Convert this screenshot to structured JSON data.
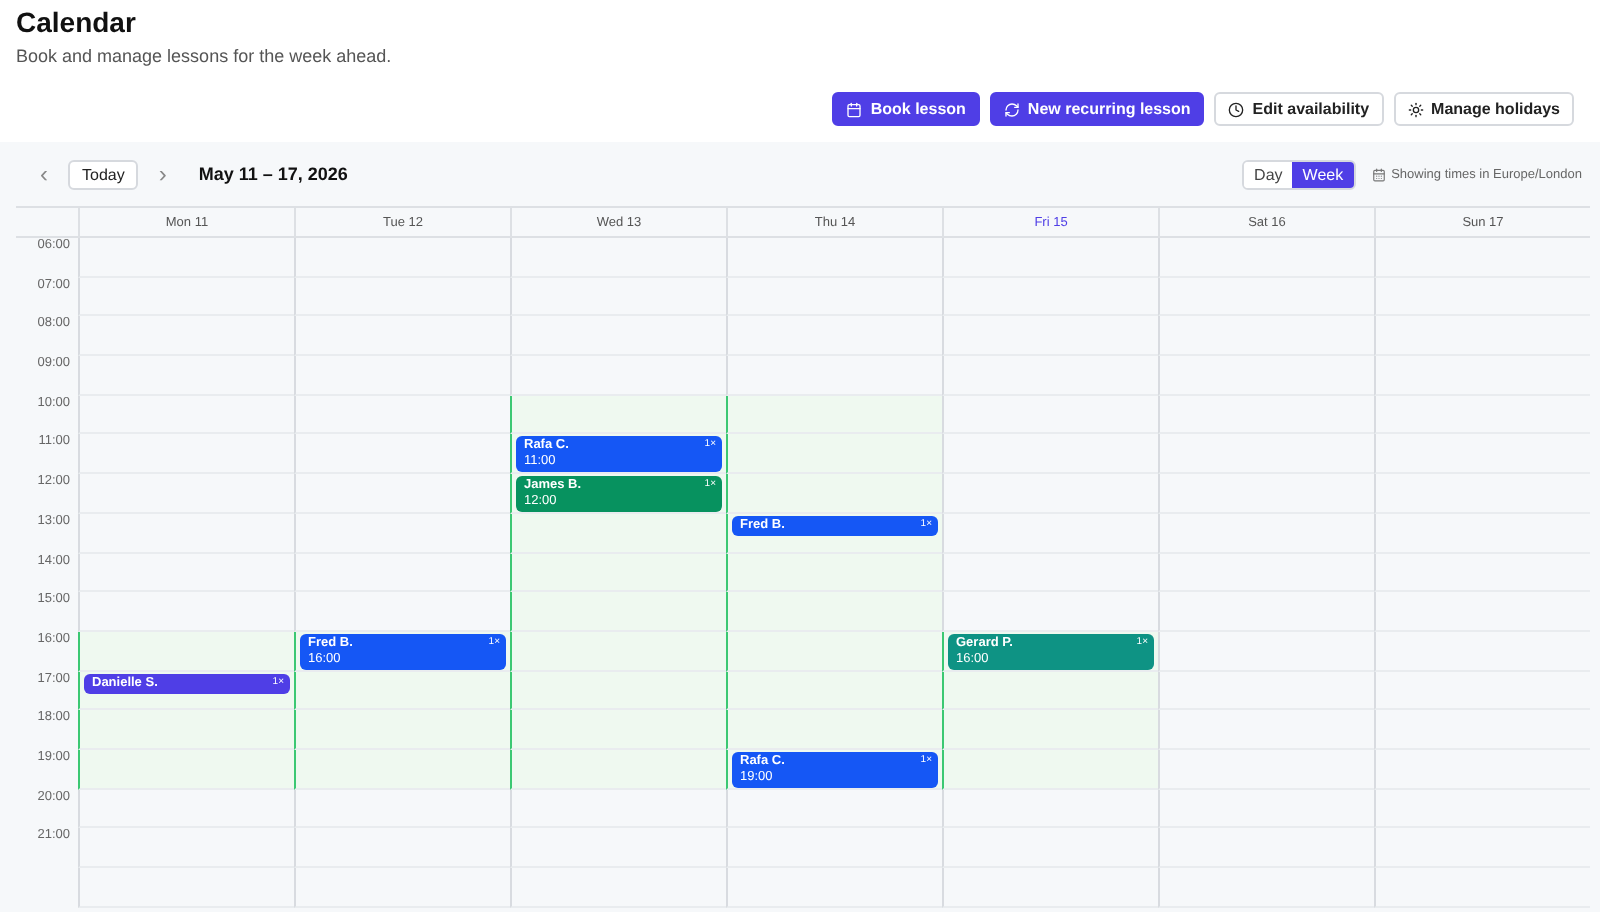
{
  "header": {
    "title": "Calendar",
    "subtitle": "Book and manage lessons for the week ahead."
  },
  "actions": [
    {
      "label": "Book lesson",
      "kind": "primary"
    },
    {
      "label": "New recurring lesson",
      "kind": "primary"
    },
    {
      "label": "Edit availability",
      "kind": "secondary"
    },
    {
      "label": "Manage holidays",
      "kind": "secondary"
    }
  ],
  "toolbar": {
    "prev": "‹",
    "today": "Today",
    "next": "›",
    "range": "May 11 – 17, 2026",
    "views": [
      {
        "label": "Day",
        "selected": false
      },
      {
        "label": "Week",
        "selected": true
      }
    ],
    "timezone": "Showing times in Europe/London"
  },
  "days": [
    {
      "label": "Mon 11",
      "selected": false
    },
    {
      "label": "Tue 12",
      "selected": false
    },
    {
      "label": "Wed 13",
      "selected": false
    },
    {
      "label": "Thu 14",
      "selected": false
    },
    {
      "label": "Fri 15",
      "selected": true
    },
    {
      "label": "Sat 16",
      "selected": false
    },
    {
      "label": "Sun 17",
      "selected": false
    }
  ],
  "rows": [
    {
      "label": "06:00",
      "cells": [
        {
          "kind": "closed"
        },
        {
          "kind": "closed"
        },
        {
          "kind": "closed"
        },
        {
          "kind": "closed"
        },
        {
          "kind": "closed"
        },
        {
          "kind": "closed"
        },
        {
          "kind": "closed"
        }
      ]
    },
    {
      "label": "07:00",
      "cells": [
        {
          "kind": "closed"
        },
        {
          "kind": "closed"
        },
        {
          "kind": "closed"
        },
        {
          "kind": "closed"
        },
        {
          "kind": "closed"
        },
        {
          "kind": "closed"
        },
        {
          "kind": "closed"
        }
      ]
    },
    {
      "label": "08:00",
      "cells": [
        {
          "kind": "closed"
        },
        {
          "kind": "closed"
        },
        {
          "kind": "closed"
        },
        {
          "kind": "closed"
        },
        {
          "kind": "closed"
        },
        {
          "kind": "closed"
        },
        {
          "kind": "closed"
        }
      ]
    },
    {
      "label": "09:00",
      "cells": [
        {
          "kind": "closed"
        },
        {
          "kind": "closed"
        },
        {
          "kind": "closed"
        },
        {
          "kind": "closed"
        },
        {
          "kind": "closed"
        },
        {
          "kind": "closed"
        },
        {
          "kind": "closed"
        }
      ]
    },
    {
      "label": "10:00",
      "cells": [
        {
          "kind": "closed"
        },
        {
          "kind": "closed"
        },
        {
          "kind": "open"
        },
        {
          "kind": "open"
        },
        {
          "kind": "closed"
        },
        {
          "kind": "closed"
        },
        {
          "kind": "closed"
        }
      ]
    },
    {
      "label": "11:00",
      "cells": [
        {
          "kind": "closed"
        },
        {
          "kind": "closed"
        },
        {
          "kind": "open",
          "event": {
            "name": "Rafa C.",
            "badge": "1×",
            "kind": "full",
            "time": "11:00",
            "color": "#1557f5"
          }
        },
        {
          "kind": "open"
        },
        {
          "kind": "closed"
        },
        {
          "kind": "closed"
        },
        {
          "kind": "closed"
        }
      ]
    },
    {
      "label": "12:00",
      "cells": [
        {
          "kind": "closed"
        },
        {
          "kind": "closed"
        },
        {
          "kind": "open",
          "event": {
            "name": "James B.",
            "badge": "1×",
            "kind": "full",
            "time": "12:00",
            "color": "#07925f"
          }
        },
        {
          "kind": "open"
        },
        {
          "kind": "closed"
        },
        {
          "kind": "closed"
        },
        {
          "kind": "closed"
        }
      ]
    },
    {
      "label": "13:00",
      "cells": [
        {
          "kind": "closed"
        },
        {
          "kind": "closed"
        },
        {
          "kind": "open"
        },
        {
          "kind": "open",
          "event": {
            "name": "Fred B.",
            "badge": "1×",
            "kind": "short",
            "color": "#1557f5"
          }
        },
        {
          "kind": "closed"
        },
        {
          "kind": "closed"
        },
        {
          "kind": "closed"
        }
      ]
    },
    {
      "label": "14:00",
      "cells": [
        {
          "kind": "closed"
        },
        {
          "kind": "closed"
        },
        {
          "kind": "open"
        },
        {
          "kind": "open"
        },
        {
          "kind": "closed"
        },
        {
          "kind": "closed"
        },
        {
          "kind": "closed"
        }
      ]
    },
    {
      "label": "15:00",
      "cells": [
        {
          "kind": "closed"
        },
        {
          "kind": "closed"
        },
        {
          "kind": "open"
        },
        {
          "kind": "open"
        },
        {
          "kind": "closed"
        },
        {
          "kind": "closed"
        },
        {
          "kind": "closed"
        }
      ]
    },
    {
      "label": "16:00",
      "cells": [
        {
          "kind": "open"
        },
        {
          "kind": "open",
          "event": {
            "name": "Fred B.",
            "badge": "1×",
            "kind": "full",
            "time": "16:00",
            "color": "#1557f5"
          }
        },
        {
          "kind": "open"
        },
        {
          "kind": "open"
        },
        {
          "kind": "open",
          "event": {
            "name": "Gerard P.",
            "badge": "1×",
            "kind": "full",
            "time": "16:00",
            "color": "#0e9384"
          }
        },
        {
          "kind": "closed"
        },
        {
          "kind": "closed"
        }
      ]
    },
    {
      "label": "17:00",
      "cells": [
        {
          "kind": "open",
          "event": {
            "name": "Danielle S.",
            "badge": "1×",
            "kind": "short",
            "color": "#4f3ee6"
          }
        },
        {
          "kind": "open"
        },
        {
          "kind": "open"
        },
        {
          "kind": "open"
        },
        {
          "kind": "open"
        },
        {
          "kind": "closed"
        },
        {
          "kind": "closed"
        }
      ]
    },
    {
      "label": "18:00",
      "cells": [
        {
          "kind": "open"
        },
        {
          "kind": "open"
        },
        {
          "kind": "open"
        },
        {
          "kind": "open"
        },
        {
          "kind": "open"
        },
        {
          "kind": "closed"
        },
        {
          "kind": "closed"
        }
      ]
    },
    {
      "label": "19:00",
      "cells": [
        {
          "kind": "open"
        },
        {
          "kind": "open"
        },
        {
          "kind": "open"
        },
        {
          "kind": "open",
          "event": {
            "name": "Rafa C.",
            "badge": "1×",
            "kind": "full",
            "time": "19:00",
            "color": "#1557f5"
          }
        },
        {
          "kind": "open"
        },
        {
          "kind": "closed"
        },
        {
          "kind": "closed"
        }
      ]
    },
    {
      "label": "20:00",
      "cells": [
        {
          "kind": "closed"
        },
        {
          "kind": "closed"
        },
        {
          "kind": "closed"
        },
        {
          "kind": "closed"
        },
        {
          "kind": "closed"
        },
        {
          "kind": "closed"
        },
        {
          "kind": "closed"
        }
      ]
    },
    {
      "label": "21:00",
      "cells": [
        {
          "kind": "closed"
        },
        {
          "kind": "closed"
        },
        {
          "kind": "closed"
        },
        {
          "kind": "closed"
        },
        {
          "kind": "closed"
        },
        {
          "kind": "closed"
        },
        {
          "kind": "closed"
        }
      ]
    },
    {
      "cells": [
        {
          "kind": "closed"
        },
        {
          "kind": "closed"
        },
        {
          "kind": "closed"
        },
        {
          "kind": "closed"
        },
        {
          "kind": "closed"
        },
        {
          "kind": "closed"
        },
        {
          "kind": "closed"
        }
      ]
    }
  ]
}
